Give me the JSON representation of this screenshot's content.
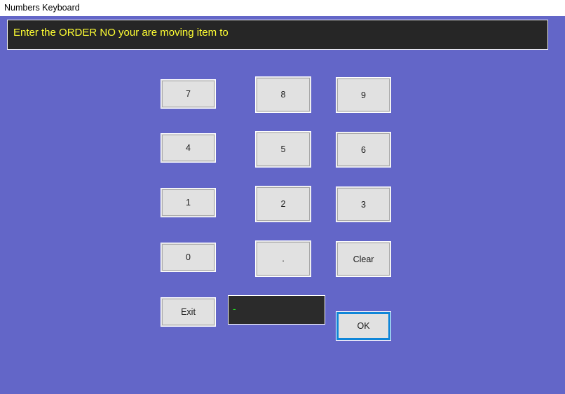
{
  "window": {
    "title": "Numbers Keyboard",
    "background_color": "#6366c8"
  },
  "prompt": {
    "text": "Enter the ORDER NO your are moving item to",
    "background_color": "#262626",
    "text_color": "#ffff33"
  },
  "display": {
    "value": "-",
    "background_color": "#2b2b2b",
    "text_color": "#22dd22"
  },
  "keypad": {
    "row1": [
      {
        "label": "7",
        "name": "key-7"
      },
      {
        "label": "8",
        "name": "key-8"
      },
      {
        "label": "9",
        "name": "key-9"
      }
    ],
    "row2": [
      {
        "label": "4",
        "name": "key-4"
      },
      {
        "label": "5",
        "name": "key-5"
      },
      {
        "label": "6",
        "name": "key-6"
      }
    ],
    "row3": [
      {
        "label": "1",
        "name": "key-1"
      },
      {
        "label": "2",
        "name": "key-2"
      },
      {
        "label": "3",
        "name": "key-3"
      }
    ],
    "row4": [
      {
        "label": "0",
        "name": "key-0"
      },
      {
        "label": ".",
        "name": "key-decimal"
      },
      {
        "label": "Clear",
        "name": "key-clear"
      }
    ],
    "row5": [
      {
        "label": "Exit",
        "name": "key-exit"
      },
      {
        "label": "OK",
        "name": "key-ok"
      }
    ]
  },
  "actions": {
    "exit_label": "Exit",
    "ok_label": "OK",
    "clear_label": "Clear",
    "focused_button": "OK",
    "focus_color": "#0f86d8"
  }
}
